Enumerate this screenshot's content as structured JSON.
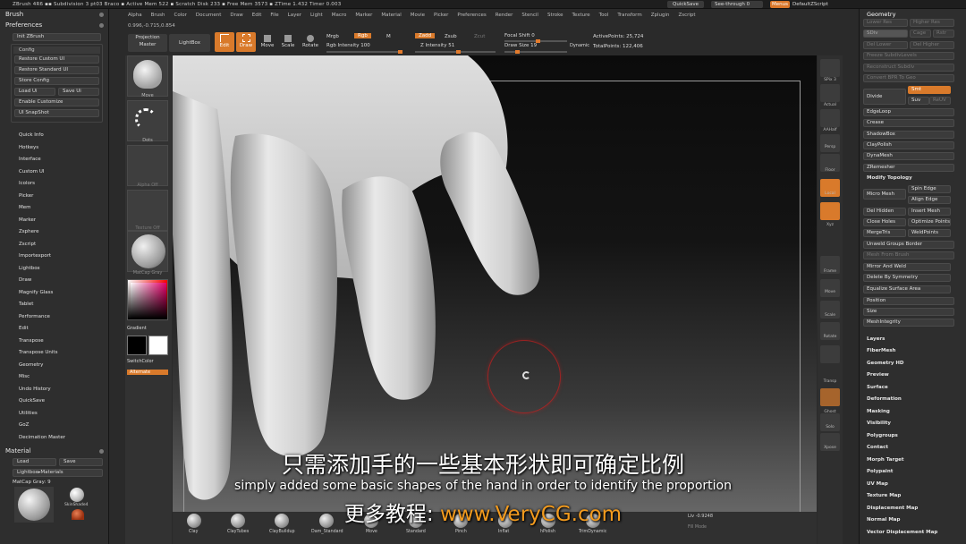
{
  "titlebar": {
    "text": "ZBrush 4R6   ▪▪ Subdivision 3 pt03 Braco   ▪ Active Mem 522 ▪ Scratch Disk 233 ▪ Free Mem 3573 ▪ ZTime 1.432 Timer 0.003",
    "quicksave": "QuickSave",
    "seethrough": "See-through  0",
    "menus": "Menus",
    "defaultzscript": "DefaultZScript"
  },
  "menubar": [
    "Alpha",
    "Brush",
    "Color",
    "Document",
    "Draw",
    "Edit",
    "File",
    "Layer",
    "Light",
    "Macro",
    "Marker",
    "Material",
    "Movie",
    "Picker",
    "Preferences",
    "Render",
    "Stencil",
    "Stroke",
    "Texture",
    "Tool",
    "Transform",
    "Zplugin",
    "Zscript"
  ],
  "coords": "0.996,-0.715,0.854",
  "left": {
    "brush_title": "Brush",
    "prefs_title": "Preferences",
    "init_zbrush": "Init ZBrush",
    "config": {
      "title": "Config",
      "restore_custom": "Restore Custom UI",
      "restore_standard": "Restore Standard UI",
      "store_config": "Store Config",
      "load_ui": "Load Ui",
      "save_ui": "Save Ui",
      "enable_customize": "Enable Customize",
      "ui_snapshot": "UI SnapShot"
    },
    "items": [
      "Quick Info",
      "Hotkeys",
      "Interface",
      "Custom UI",
      "Icolors",
      "Picker",
      "Mem",
      "Marker",
      "Zsphere",
      "Zscript",
      "Importexport",
      "Lightbox",
      "Draw",
      "Magnify Glass",
      "Tablet",
      "Performance",
      "Edit",
      "Transpose",
      "Transpose Units",
      "Geometry",
      "Misc",
      "Undo History",
      "QuickSave",
      "Utilities",
      "GoZ",
      "Decimation Master"
    ],
    "material_title": "Material",
    "load": "Load",
    "save": "Save",
    "lightbox_materials": "Lightbox▸Materials",
    "matcap": "MatCap Gray: 9",
    "mat_labels": [
      "SkinShade4",
      "MatCap Red"
    ]
  },
  "toolbar": {
    "projection_master": "Projection Master",
    "lightbox": "LightBox",
    "edit": "Edit",
    "draw": "Draw",
    "move": "Move",
    "scale": "Scale",
    "rotate": "Rotate",
    "mrgb": "Mrgb",
    "rgb": "Rgb",
    "m": "M",
    "rgb_intensity": "Rgb Intensity 100",
    "zadd": "Zadd",
    "zsub": "Zsub",
    "zcut": "Zcut",
    "z_intensity": "Z Intensity 51",
    "focal_shift": "Focal Shift 0",
    "draw_size": "Draw Size 19",
    "dynamic": "Dynamic",
    "active_points": "ActivePoints: 25,724",
    "total_points": "TotalPoints: 122,406"
  },
  "shelf": [
    "Move",
    "Dots",
    "Alpha Off",
    "Texture Off",
    "MatCap Gray"
  ],
  "color": {
    "gradient": "Gradient",
    "switch": "SwitchColor",
    "alternate": "Alternate"
  },
  "rshelf": [
    "SPix 3",
    "Actual",
    "AAHalf",
    "Persp",
    "Floor",
    "Local",
    "Xyz",
    "Frame",
    "Move",
    "Scale",
    "Rotate",
    "Transp",
    "Ghost",
    "Solo",
    "Xpose"
  ],
  "geometry": {
    "title": "Geometry",
    "lower_res": "Lower Res",
    "higher_res": "Higher Res",
    "sdiv": "SDiv",
    "cage": "Cage",
    "rstr": "Rstr",
    "del_lower": "Del Lower",
    "del_higher": "Del Higher",
    "freeze_subdiv": "Freeze SubdivLevels",
    "reconstruct": "Reconstruct Subdiv",
    "convert_bpr": "Convert BPR To Geo",
    "divide": "Divide",
    "smt": "Smt",
    "suv": "Suv",
    "reuv": "ReUV",
    "edgeloop": "EdgeLoop",
    "crease": "Crease",
    "shadowbox": "ShadowBox",
    "claypolish": "ClayPolish",
    "dynamesh": "DynaMesh",
    "zremesher": "ZRemesher",
    "modify_topology": "Modify Topology",
    "micro_mesh": "Micro Mesh",
    "spin_edge": "Spin Edge",
    "align_edge": "Align Edge",
    "del_hidden": "Del Hidden",
    "insert_mesh": "Insert Mesh",
    "close_holes": "Close Holes",
    "optimize_points": "Optimize Points",
    "mergetris": "MergeTris",
    "weldpoints": "WeldPoints",
    "unweld_groups": "Unweld Groups Border",
    "mesh_from_brush": "Mesh From Brush",
    "mirror_weld": "Mirror And Weld",
    "delete_symmetry": "Delete By Symmetry",
    "equalize": "Equalize Surface Area",
    "position": "Position",
    "size": "Size",
    "meshintegrity": "MeshIntegrity"
  },
  "right_items": [
    "Layers",
    "FiberMesh",
    "Geometry HD",
    "Preview",
    "Surface",
    "Deformation",
    "Masking",
    "Visibility",
    "Polygroups",
    "Contact",
    "Morph Target",
    "Polypaint",
    "UV Map",
    "Texture Map",
    "Displacement Map",
    "Normal Map",
    "Vector Displacement Map"
  ],
  "bottom": {
    "brushes": [
      "Clay",
      "ClayTubes",
      "ClayBuildup",
      "Dam_Standard",
      "Move",
      "Standard",
      "Pinch",
      "Inflat",
      "hPolish",
      "TrimDynamic"
    ],
    "liv": "Liv -0.9248",
    "fill_mode": "Fill Mode"
  },
  "subtitle": {
    "cn": "只需添加手的一些基本形状即可确定比例",
    "en": "simply added some basic shapes of the hand in order to identify the proportion",
    "site_cn": "更多教程: ",
    "site_url": "www.VeryCG.com"
  },
  "colors": {
    "accent": "#d97a2b",
    "subtitle_url": "#f39b1e"
  }
}
